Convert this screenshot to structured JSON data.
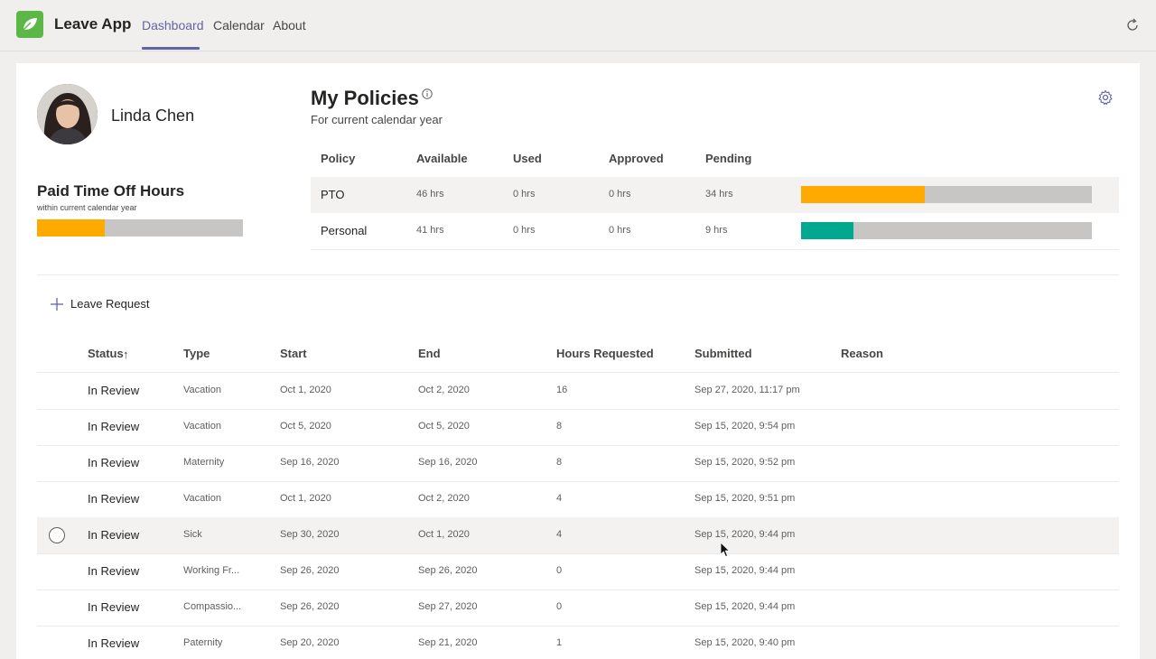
{
  "app": {
    "title": "Leave App",
    "tabs": [
      {
        "label": "Dashboard",
        "active": true
      },
      {
        "label": "Calendar",
        "active": false
      },
      {
        "label": "About",
        "active": false
      }
    ],
    "accent_color": "#6264a7",
    "logo_color": "#5bb846"
  },
  "user": {
    "name": "Linda Chen"
  },
  "pto_summary": {
    "title": "Paid Time Off Hours",
    "subtitle": "within current calendar year",
    "used_fraction": 0.33,
    "fill_color": "#ffaa00"
  },
  "policies": {
    "title": "My Policies",
    "subtitle": "For current calendar year",
    "headers": [
      "Policy",
      "Available",
      "Used",
      "Approved",
      "Pending"
    ],
    "rows": [
      {
        "policy": "PTO",
        "available": "46 hrs",
        "used": "0 hrs",
        "approved": "0 hrs",
        "pending": "34 hrs",
        "fill_fraction": 0.425,
        "fill_color": "#ffaa00"
      },
      {
        "policy": "Personal",
        "available": "41 hrs",
        "used": "0 hrs",
        "approved": "0 hrs",
        "pending": "9 hrs",
        "fill_fraction": 0.18,
        "fill_color": "#00a88f"
      }
    ]
  },
  "leave_request_label": "Leave Request",
  "requests": {
    "headers": [
      "Status",
      "Type",
      "Start",
      "End",
      "Hours Requested",
      "Submitted",
      "Reason"
    ],
    "sort_indicator": "↑",
    "rows": [
      {
        "status": "In Review",
        "type": "Vacation",
        "start": "Oct 1, 2020",
        "end": "Oct 2, 2020",
        "hours": "16",
        "submitted": "Sep 27, 2020, 11:17 pm",
        "reason": ""
      },
      {
        "status": "In Review",
        "type": "Vacation",
        "start": "Oct 5, 2020",
        "end": "Oct 5, 2020",
        "hours": "8",
        "submitted": "Sep 15, 2020, 9:54 pm",
        "reason": ""
      },
      {
        "status": "In Review",
        "type": "Maternity",
        "start": "Sep 16, 2020",
        "end": "Sep 16, 2020",
        "hours": "8",
        "submitted": "Sep 15, 2020, 9:52 pm",
        "reason": ""
      },
      {
        "status": "In Review",
        "type": "Vacation",
        "start": "Oct 1, 2020",
        "end": "Oct 2, 2020",
        "hours": "4",
        "submitted": "Sep 15, 2020, 9:51 pm",
        "reason": ""
      },
      {
        "status": "In Review",
        "type": "Sick",
        "start": "Sep 30, 2020",
        "end": "Oct 1, 2020",
        "hours": "4",
        "submitted": "Sep 15, 2020, 9:44 pm",
        "reason": ""
      },
      {
        "status": "In Review",
        "type": "Working Fr...",
        "start": "Sep 26, 2020",
        "end": "Sep 26, 2020",
        "hours": "0",
        "submitted": "Sep 15, 2020, 9:44 pm",
        "reason": ""
      },
      {
        "status": "In Review",
        "type": "Compassio...",
        "start": "Sep 26, 2020",
        "end": "Sep 27, 2020",
        "hours": "0",
        "submitted": "Sep 15, 2020, 9:44 pm",
        "reason": ""
      },
      {
        "status": "In Review",
        "type": "Paternity",
        "start": "Sep 20, 2020",
        "end": "Sep 21, 2020",
        "hours": "1",
        "submitted": "Sep 15, 2020, 9:40 pm",
        "reason": ""
      }
    ]
  }
}
